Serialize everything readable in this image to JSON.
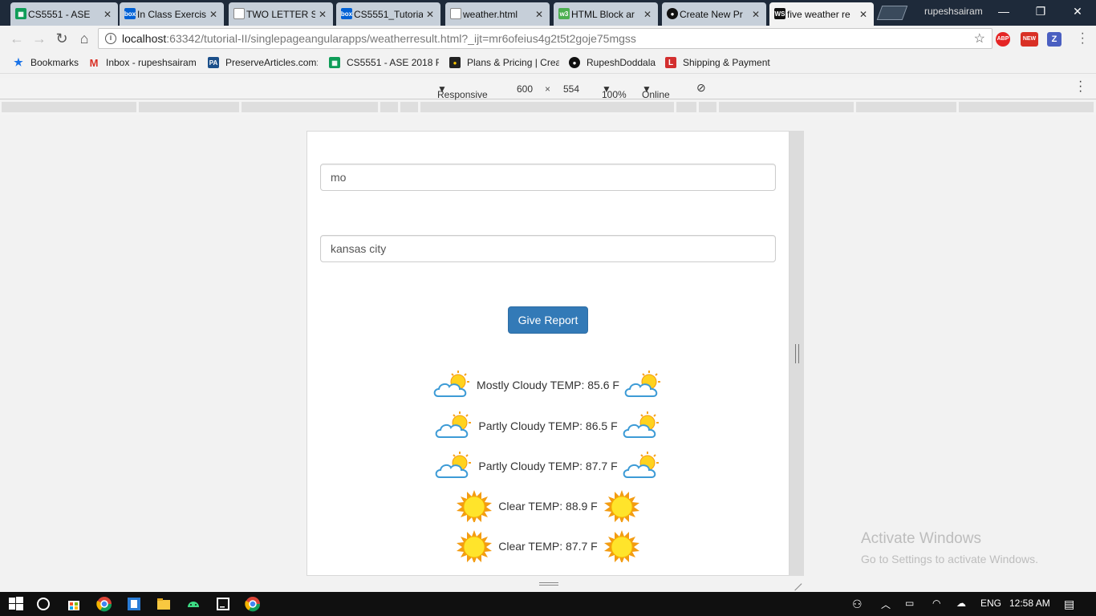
{
  "tabs": [
    {
      "label": "CS5551 - ASE",
      "icon": "sheets-icon",
      "color": "#0f9d58"
    },
    {
      "label": "In Class Exercise",
      "icon": "box-icon",
      "color": "#0061d5"
    },
    {
      "label": "TWO LETTER S",
      "icon": "document-icon",
      "color": "#888888"
    },
    {
      "label": "CS5551_Tutorial",
      "icon": "box-icon",
      "color": "#0061d5"
    },
    {
      "label": "weather.html",
      "icon": "document-icon",
      "color": "#888888"
    },
    {
      "label": "HTML Block ar",
      "icon": "w3-icon",
      "color": "#4caf50"
    },
    {
      "label": "Create New Pr",
      "icon": "github-icon",
      "color": "#111111"
    },
    {
      "label": "five weather re",
      "icon": "webstorm-icon",
      "color": "#111111"
    }
  ],
  "profile": "rupeshsairam",
  "address": {
    "host": "localhost",
    "path": ":63342/tutorial-II/singlepageangularapps/weatherresult.html?_ijt=mr6ofeius4g2t5t2goje75mgss"
  },
  "extensions": {
    "abp": "ABP",
    "new": "NEW",
    "z": "Z"
  },
  "bookmarks": [
    {
      "label": "Bookmarks",
      "icon": "star-icon",
      "color": "#1a73e8"
    },
    {
      "label": "Inbox - rupeshsairam",
      "icon": "gmail-icon",
      "color": "#d93025"
    },
    {
      "label": "PreserveArticles.com:",
      "icon": "pa-icon",
      "color": "#1b4f8a"
    },
    {
      "label": "CS5551 - ASE 2018 Fa",
      "icon": "sheets-icon",
      "color": "#0f9d58"
    },
    {
      "label": "Plans & Pricing | Crea",
      "icon": "bulb-icon",
      "color": "#222222"
    },
    {
      "label": "RupeshDoddala",
      "icon": "github-icon",
      "color": "#111111"
    },
    {
      "label": "Shipping & Payment",
      "icon": "l-icon",
      "color": "#d32f2f"
    }
  ],
  "device_toolbar": {
    "mode": "Responsive",
    "width": "600",
    "times": "×",
    "height": "554",
    "zoom": "100%",
    "network": "Online"
  },
  "form": {
    "state_value": "mo",
    "city_value": "kansas city",
    "button_label": "Give Report"
  },
  "forecast": [
    {
      "text": "Mostly Cloudy TEMP: 85.6 F",
      "icon": "partly-cloudy"
    },
    {
      "text": "Partly Cloudy TEMP: 86.5 F",
      "icon": "partly-cloudy"
    },
    {
      "text": "Partly Cloudy TEMP: 87.7 F",
      "icon": "partly-cloudy"
    },
    {
      "text": "Clear TEMP: 88.9 F",
      "icon": "sun"
    },
    {
      "text": "Clear TEMP: 87.7 F",
      "icon": "sun"
    }
  ],
  "watermark": {
    "title": "Activate Windows",
    "subtitle": "Go to Settings to activate Windows."
  },
  "taskbar": {
    "language": "ENG",
    "time": "12:58 AM"
  },
  "colors": {
    "primary_button": "#337ab7",
    "titlebar": "#1e2a3a"
  }
}
